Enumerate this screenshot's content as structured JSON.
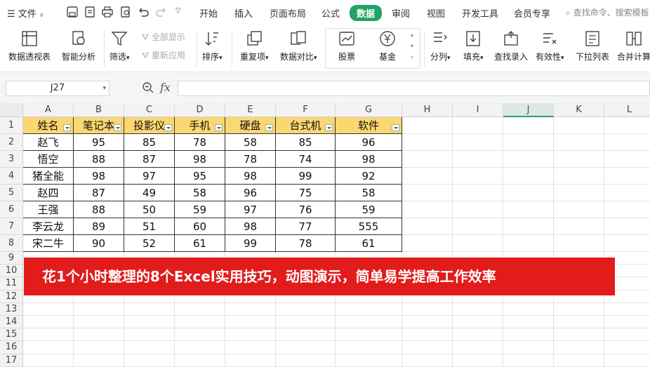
{
  "menubar": {
    "file_label": "文件",
    "tabs": [
      "开始",
      "插入",
      "页面布局",
      "公式",
      "数据",
      "审阅",
      "视图",
      "开发工具",
      "会员专享"
    ],
    "active_tab": "数据",
    "search_placeholder": "查找命令、搜索模板"
  },
  "ribbon": {
    "pivot": "数据透视表",
    "smart": "智能分析",
    "filter": "筛选",
    "show_all": "全部显示",
    "reapply": "重新应用",
    "sort": "排序",
    "duplicate": "重复项",
    "compare": "数据对比",
    "stock": "股票",
    "fund": "基金",
    "split": "分列",
    "fill": "填充",
    "lookup": "查找录入",
    "validity": "有效性",
    "dropdown": "下拉列表",
    "merge": "合并计算"
  },
  "formula_bar": {
    "name_box": "J27",
    "fx_label": "fx",
    "formula": ""
  },
  "grid": {
    "columns": [
      "A",
      "B",
      "C",
      "D",
      "E",
      "F",
      "G",
      "H",
      "I",
      "J",
      "K",
      "L"
    ],
    "selected_column": "J",
    "rows": [
      "1",
      "2",
      "3",
      "4",
      "5",
      "6",
      "7",
      "8",
      "9",
      "10",
      "11",
      "12",
      "13",
      "14",
      "15",
      "16",
      "17"
    ],
    "table_header": [
      "姓名",
      "笔记本",
      "投影仪",
      "手机",
      "硬盘",
      "台式机",
      "软件"
    ],
    "table_rows": [
      [
        "赵飞",
        "95",
        "85",
        "78",
        "58",
        "85",
        "96"
      ],
      [
        "悟空",
        "88",
        "87",
        "98",
        "78",
        "74",
        "98"
      ],
      [
        "猪全能",
        "98",
        "97",
        "95",
        "98",
        "99",
        "92"
      ],
      [
        "赵四",
        "87",
        "49",
        "58",
        "96",
        "75",
        "58"
      ],
      [
        "王强",
        "88",
        "50",
        "59",
        "97",
        "76",
        "59"
      ],
      [
        "李云龙",
        "89",
        "51",
        "60",
        "98",
        "77",
        "555"
      ],
      [
        "宋二牛",
        "90",
        "52",
        "61",
        "99",
        "78",
        "61"
      ]
    ]
  },
  "banner": {
    "text": "花1个小时整理的8个Excel实用技巧，动图演示，简单易学提高工作效率",
    "color": "#e21b1b"
  },
  "colors": {
    "accent": "#21a366",
    "header_fill": "#fbd772"
  }
}
